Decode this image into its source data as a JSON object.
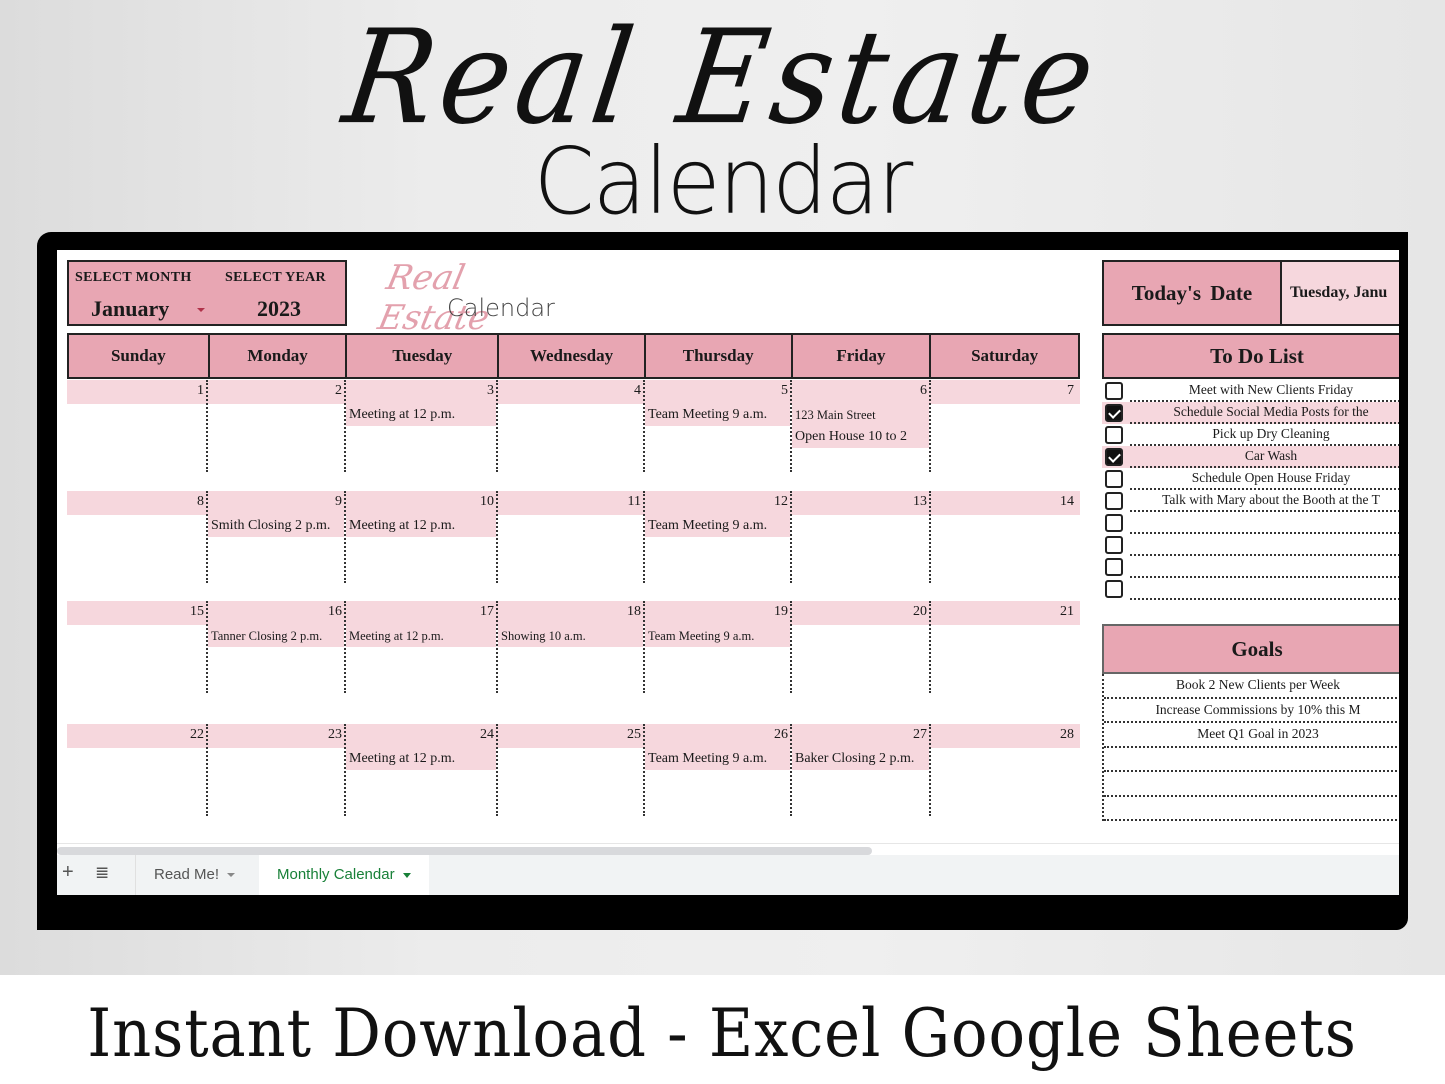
{
  "hero": {
    "title_script": "Real Estate",
    "title_sub": "Calendar",
    "banner": "Instant Download - Excel Google Sheets"
  },
  "selector": {
    "month_label": "SELECT MONTH",
    "year_label": "SELECT YEAR",
    "month_value": "January",
    "year_value": "2023"
  },
  "logo": {
    "script": "Real Estate",
    "sub": "Calendar"
  },
  "colors": {
    "header_pink": "#e8a6b3",
    "light_pink": "#f6d7dd",
    "active_tab": "#188038"
  },
  "days": [
    "Sunday",
    "Monday",
    "Tuesday",
    "Wednesday",
    "Thursday",
    "Friday",
    "Saturday"
  ],
  "weeks": [
    {
      "dates": [
        "1",
        "2",
        "3",
        "4",
        "5",
        "6",
        "7"
      ],
      "events": [
        [],
        [],
        [
          "Meeting at 12 p.m."
        ],
        [],
        [
          "Team Meeting 9 a.m."
        ],
        [
          "123 Main Street",
          "Open House 10 to 2"
        ],
        []
      ]
    },
    {
      "dates": [
        "8",
        "9",
        "10",
        "11",
        "12",
        "13",
        "14"
      ],
      "events": [
        [],
        [
          "Smith Closing 2 p.m."
        ],
        [
          "Meeting at 12 p.m."
        ],
        [],
        [
          "Team Meeting 9 a.m."
        ],
        [],
        []
      ]
    },
    {
      "dates": [
        "15",
        "16",
        "17",
        "18",
        "19",
        "20",
        "21"
      ],
      "events": [
        [],
        [
          "Tanner Closing 2 p.m."
        ],
        [
          "Meeting at 12 p.m."
        ],
        [
          "Showing 10 a.m."
        ],
        [
          "Team Meeting 9 a.m."
        ],
        [],
        []
      ]
    },
    {
      "dates": [
        "22",
        "23",
        "24",
        "25",
        "26",
        "27",
        "28"
      ],
      "events": [
        [],
        [],
        [
          "Meeting at 12 p.m."
        ],
        [],
        [
          "Team Meeting 9 a.m."
        ],
        [
          "Baker Closing 2 p.m."
        ],
        []
      ]
    }
  ],
  "today": {
    "label": "Today's Date",
    "value": "Tuesday, Janu"
  },
  "todo": {
    "title": "To Do List",
    "items": [
      {
        "text": "Meet with New Clients Friday",
        "checked": false
      },
      {
        "text": "Schedule Social Media Posts for the",
        "checked": true
      },
      {
        "text": "Pick up Dry Cleaning",
        "checked": false
      },
      {
        "text": "Car Wash",
        "checked": true
      },
      {
        "text": "Schedule Open House Friday",
        "checked": false
      },
      {
        "text": "Talk with Mary about the Booth at the T",
        "checked": false
      },
      {
        "text": "",
        "checked": false
      },
      {
        "text": "",
        "checked": false
      },
      {
        "text": "",
        "checked": false
      },
      {
        "text": "",
        "checked": false
      }
    ]
  },
  "goals": {
    "title": "Goals",
    "items": [
      "Book 2 New Clients per Week",
      "Increase Commissions by 10% this M",
      "Meet Q1 Goal in 2023",
      "",
      "",
      ""
    ]
  },
  "sheets": {
    "add_icon": "+",
    "menu_icon": "≣",
    "tabs": [
      {
        "label": "Read Me!",
        "active": false
      },
      {
        "label": "Monthly Calendar",
        "active": true
      }
    ]
  }
}
